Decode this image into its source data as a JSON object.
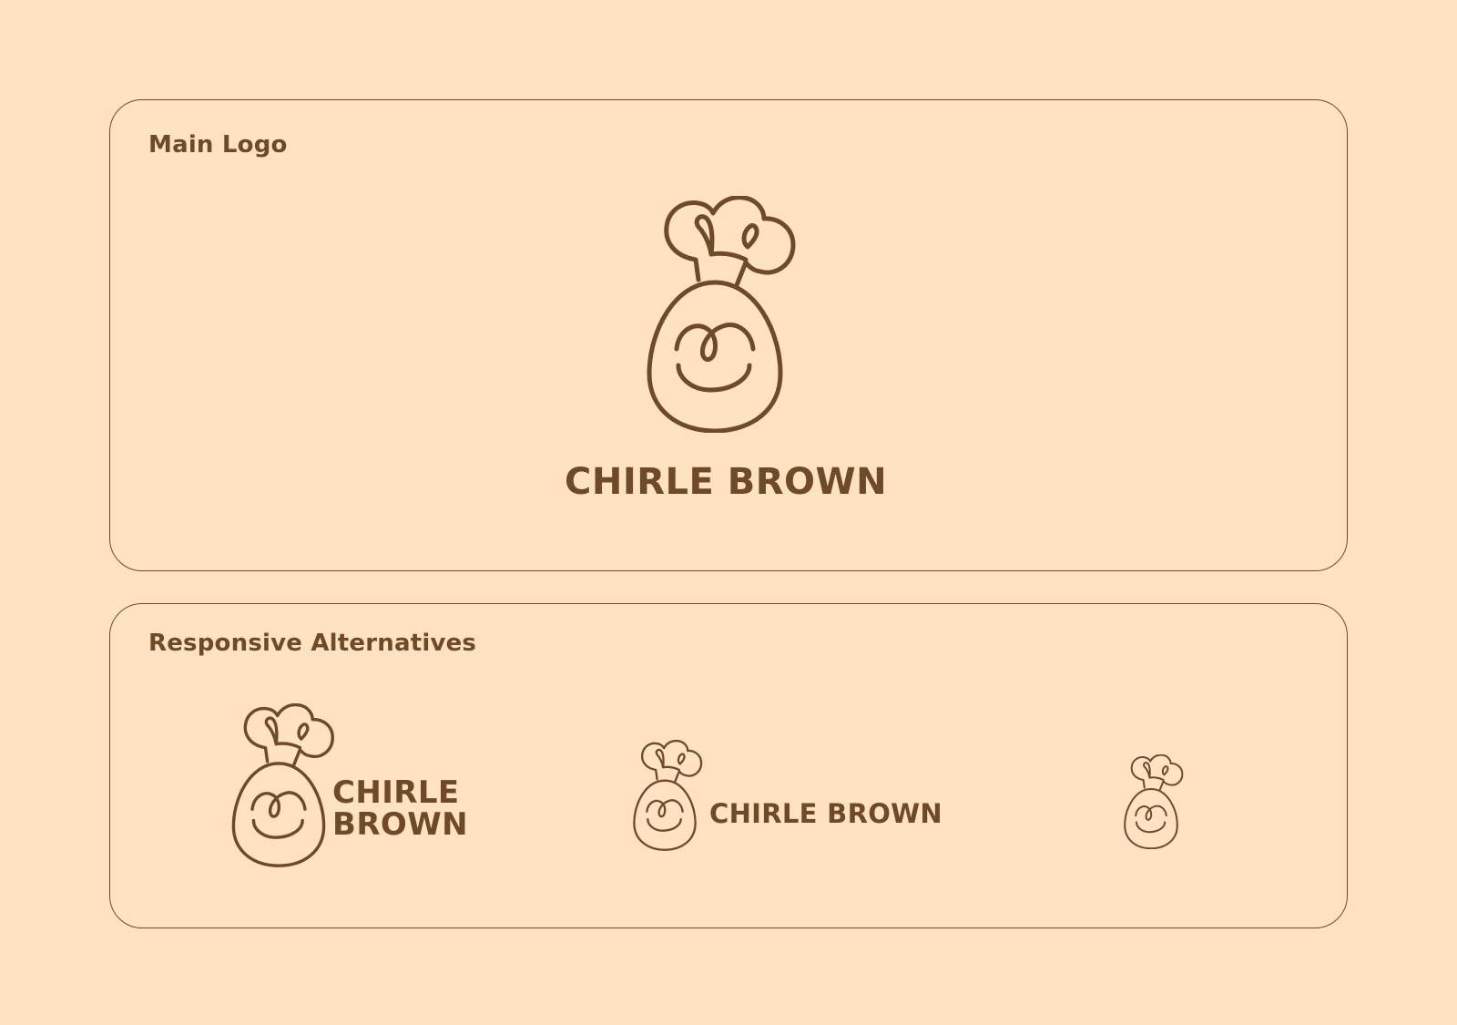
{
  "brand": {
    "name": "CHIRLE BROWN",
    "name_line1": "CHIRLE",
    "name_line2": "BROWN",
    "color": "#6E4A2A",
    "background": "#FFE2C2"
  },
  "sections": {
    "main": {
      "title": "Main Logo"
    },
    "alternatives": {
      "title": "Responsive Alternatives",
      "variants": [
        {
          "layout": "stacked",
          "mark": "chef-egg-icon"
        },
        {
          "layout": "inline",
          "mark": "chef-egg-icon"
        },
        {
          "layout": "icon-only",
          "mark": "chef-egg-icon"
        }
      ]
    }
  }
}
